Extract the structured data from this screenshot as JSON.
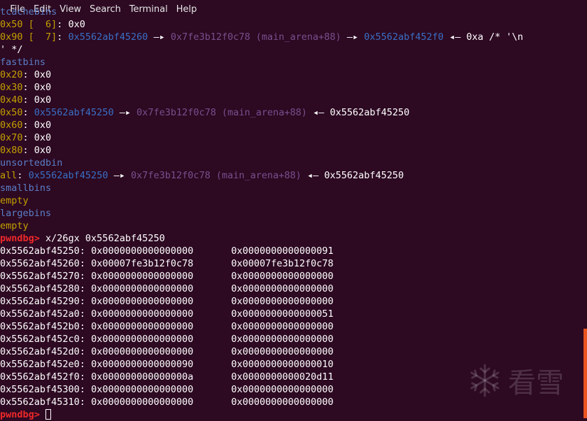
{
  "menu": [
    "File",
    "Edit",
    "View",
    "Search",
    "Terminal",
    "Help"
  ],
  "tcache": {
    "title": "tcachebins",
    "rows": [
      {
        "size": "0x50 [  6]",
        "rest": ": 0x0"
      },
      {
        "size": "0x90 [  7]",
        "colon": ": ",
        "p1": "0x5562abf45260",
        "arrow1": " —▸ ",
        "p2": "0x7fe3b12f0c78 (main_arena+88)",
        "arrow2": " —▸ ",
        "p3": "0x5562abf452f0",
        "arrow3": " ◂— ",
        "tail": "0xa /* '\\n",
        "cont": "' */"
      }
    ]
  },
  "fastbins": {
    "title": "fastbins",
    "rows": [
      {
        "size": "0x20",
        "rest": ": 0x0"
      },
      {
        "size": "0x30",
        "rest": ": 0x0"
      },
      {
        "size": "0x40",
        "rest": ": 0x0"
      },
      {
        "size": "0x50",
        "colon": ": ",
        "p1": "0x5562abf45250",
        "arrow1": " —▸ ",
        "p2": "0x7fe3b12f0c78 (main_arena+88)",
        "arrow2": " ◂— ",
        "tail": "0x5562abf45250"
      },
      {
        "size": "0x60",
        "rest": ": 0x0"
      },
      {
        "size": "0x70",
        "rest": ": 0x0"
      },
      {
        "size": "0x80",
        "rest": ": 0x0"
      }
    ]
  },
  "unsortedbin": {
    "title": "unsortedbin",
    "row": {
      "size": "all",
      "colon": ": ",
      "p1": "0x5562abf45250",
      "arrow1": " —▸ ",
      "p2": "0x7fe3b12f0c78 (main_arena+88)",
      "arrow2": " ◂— ",
      "tail": "0x5562abf45250"
    }
  },
  "smallbins": {
    "title": "smallbins",
    "value": "empty"
  },
  "largebins": {
    "title": "largebins",
    "value": "empty"
  },
  "prompt": "pwndbg>",
  "command": " x/26gx 0x5562abf45250",
  "memory": [
    {
      "addr": "0x5562abf45250:",
      "v1": "0x0000000000000000",
      "v2": "0x0000000000000091"
    },
    {
      "addr": "0x5562abf45260:",
      "v1": "0x00007fe3b12f0c78",
      "v2": "0x00007fe3b12f0c78"
    },
    {
      "addr": "0x5562abf45270:",
      "v1": "0x0000000000000000",
      "v2": "0x0000000000000000"
    },
    {
      "addr": "0x5562abf45280:",
      "v1": "0x0000000000000000",
      "v2": "0x0000000000000000"
    },
    {
      "addr": "0x5562abf45290:",
      "v1": "0x0000000000000000",
      "v2": "0x0000000000000000"
    },
    {
      "addr": "0x5562abf452a0:",
      "v1": "0x0000000000000000",
      "v2": "0x0000000000000051"
    },
    {
      "addr": "0x5562abf452b0:",
      "v1": "0x0000000000000000",
      "v2": "0x0000000000000000"
    },
    {
      "addr": "0x5562abf452c0:",
      "v1": "0x0000000000000000",
      "v2": "0x0000000000000000"
    },
    {
      "addr": "0x5562abf452d0:",
      "v1": "0x0000000000000000",
      "v2": "0x0000000000000000"
    },
    {
      "addr": "0x5562abf452e0:",
      "v1": "0x0000000000000090",
      "v2": "0x0000000000000010"
    },
    {
      "addr": "0x5562abf452f0:",
      "v1": "0x000000000000000a",
      "v2": "0x0000000000020d11"
    },
    {
      "addr": "0x5562abf45300:",
      "v1": "0x0000000000000000",
      "v2": "0x0000000000000000"
    },
    {
      "addr": "0x5562abf45310:",
      "v1": "0x0000000000000000",
      "v2": "0x0000000000000000"
    }
  ],
  "watermark": {
    "text": "看雪",
    "icon": "snowflake-icon"
  },
  "colors": {
    "background": "#2d0922",
    "header": "#5b7fc7",
    "size": "#c4a000",
    "pointer": "#3a6fc4",
    "libc": "#7a4f8e",
    "prompt": "#ef2929",
    "scrollbar": "#e95420"
  }
}
